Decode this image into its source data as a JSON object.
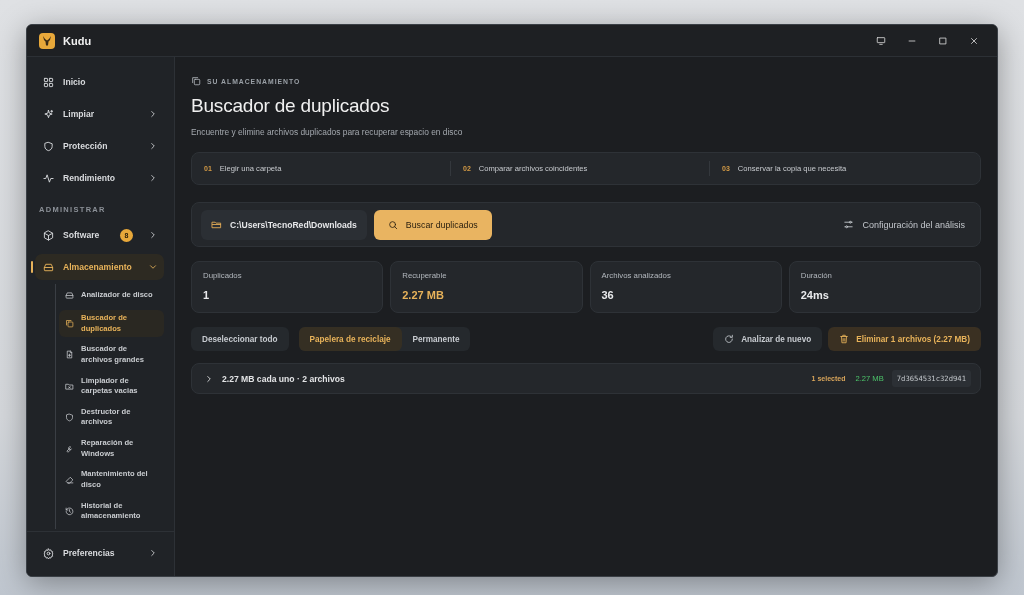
{
  "window": {
    "title": "Kudu"
  },
  "sidebar": {
    "items": [
      {
        "label": "Inicio",
        "kind": "link"
      },
      {
        "label": "Limpiar",
        "kind": "group",
        "expanded": false
      },
      {
        "label": "Protección",
        "kind": "group",
        "expanded": false
      },
      {
        "label": "Rendimiento",
        "kind": "group",
        "expanded": false
      }
    ],
    "section": "ADMINISTRAR",
    "admin_items": [
      {
        "label": "Software",
        "kind": "group",
        "expanded": false,
        "badge": "8",
        "selected": false
      },
      {
        "label": "Almacenamiento",
        "kind": "group",
        "expanded": true,
        "selected": true,
        "children": [
          {
            "label": "Analizador de disco",
            "selected": false
          },
          {
            "label": "Buscador de duplicados",
            "selected": true
          },
          {
            "label": "Buscador de archivos grandes",
            "selected": false
          },
          {
            "label": "Limpiador de carpetas vacias",
            "selected": false
          },
          {
            "label": "Destructor de archivos",
            "selected": false
          },
          {
            "label": "Reparación de Windows",
            "selected": false
          },
          {
            "label": "Mantenimiento del disco",
            "selected": false
          },
          {
            "label": "Historial de almacenamiento",
            "selected": false
          }
        ]
      }
    ],
    "footer": {
      "label": "Preferencias",
      "kind": "group",
      "expanded": false
    }
  },
  "main": {
    "eyebrow": "SU ALMACENAMIENTO",
    "title": "Buscador de duplicados",
    "subtitle": "Encuentre y elimine archivos duplicados para recuperar espacio en disco",
    "steps": [
      {
        "number": "01",
        "label": "Elegir una carpeta"
      },
      {
        "number": "02",
        "label": "Comparar archivos coincidentes"
      },
      {
        "number": "03",
        "label": "Conservar la copia que necesita"
      }
    ],
    "folder_path": "C:\\Users\\TecnoRed\\Downloads",
    "search_button": "Buscar duplicados",
    "settings_link": "Configuración del análisis",
    "stats": [
      {
        "label": "Duplicados",
        "value": "1",
        "color": "#e9eaec"
      },
      {
        "label": "Recuperable",
        "value": "2.27 MB",
        "color": "#e8b35a"
      },
      {
        "label": "Archivos analizados",
        "value": "36",
        "color": "#e9eaec"
      },
      {
        "label": "Duración",
        "value": "24ms",
        "color": "#e9eaec"
      }
    ],
    "deselect_button": "Deseleccionar todo",
    "delete_modes": [
      {
        "label": "Papelera de reciclaje",
        "selected": true
      },
      {
        "label": "Permanente",
        "selected": false
      }
    ],
    "rescan_button": "Analizar de nuevo",
    "delete_button": "Eliminar 1 archivos (2.27 MB)",
    "groups": [
      {
        "title": "2.27 MB cada uno · 2 archivos",
        "expanded": false,
        "selected_count": "1 selected",
        "size": "2.27 MB",
        "hash": "7d3654531c32d941"
      }
    ]
  }
}
